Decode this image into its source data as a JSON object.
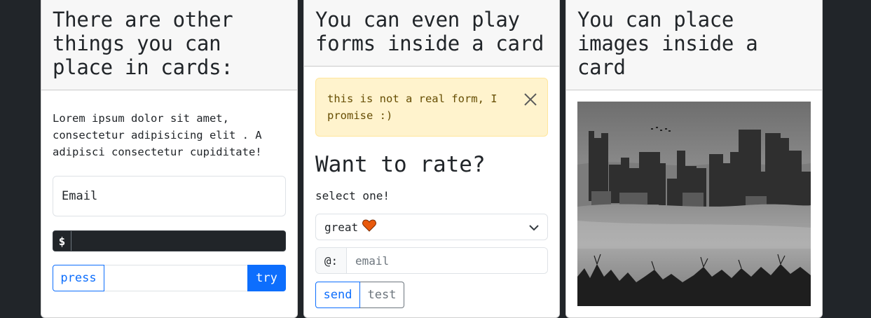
{
  "card1": {
    "header": "There are other things you can place in cards:",
    "lorem": "Lorem ipsum dolor sit amet, consectetur adipisicing elit . A adipisci consectetur cupiditate!",
    "email_label": "Email",
    "addon": "$",
    "press_label": "press",
    "try_label": "try"
  },
  "card2": {
    "header": "You can even play forms inside a card",
    "alert_text": "this is not a real form, I promise :)",
    "rate_title": "Want to rate?",
    "select_label": "select one!",
    "select_value": "great",
    "select_icon": "orange-heart-icon",
    "addon": "@:",
    "email_placeholder": "email",
    "send_label": "send",
    "test_label": "test"
  },
  "card3": {
    "header": "You can place images inside a card",
    "image": "city-skyline-in-fog-grayscale"
  },
  "colors": {
    "page_bg": "#212529",
    "primary": "#0d6efd",
    "alert_bg": "#fff3cd",
    "alert_text": "#664d03",
    "heart": "#e8590c"
  }
}
